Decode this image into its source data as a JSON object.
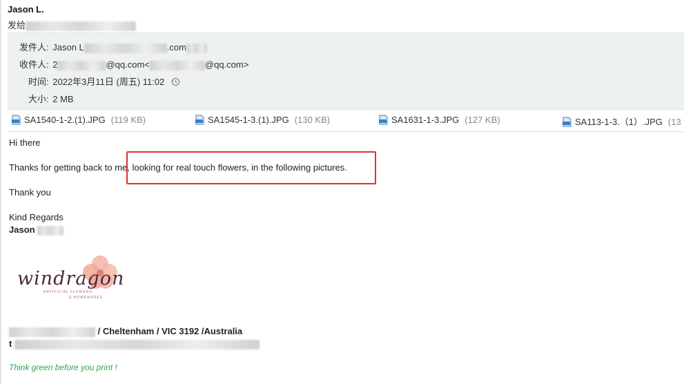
{
  "sender": {
    "name": "Jason L."
  },
  "send_to": {
    "label": "发给"
  },
  "header": {
    "from_label": "发件人:",
    "from_value": "Jason L",
    "from_email_tail": ".com",
    "to_label": "收件人:",
    "to_value_prefix": "2",
    "to_value_mid": "@qq.com<",
    "to_value_suffix": "@qq.com>",
    "time_label": "时间:",
    "time_value": "2022年3月11日 (周五) 11:02",
    "size_label": "大小:",
    "size_value": "2 MB"
  },
  "attachments": [
    {
      "name": "SA1540-1-2.(1).JPG",
      "size": "(119 KB)"
    },
    {
      "name": "SA1545-1-3.(1).JPG",
      "size": "(130 KB)"
    },
    {
      "name": "SA1631-1-3.JPG",
      "size": "(127 KB)"
    },
    {
      "name": "SA113-1-3.（1）.JPG",
      "size": "(13"
    }
  ],
  "message": {
    "greeting": "Hi there",
    "line1": "Thanks for getting back to me, looking for real touch flowers, in the following pictures.",
    "thanks": "Thank you",
    "regards": "Kind Regards",
    "signature_name": "Jason",
    "address": "/ Cheltenham / VIC 3192 /Australia",
    "phone_prefix": "t",
    "green_note": "Think green before you print !"
  },
  "logo": {
    "text": "windragon",
    "sub1": "ARTIFICIAL FLOWERS",
    "sub2": "& HOMEWARES"
  },
  "colors": {
    "header_bg": "#eef1f1",
    "highlight_border": "#e0312f",
    "green_note": "#2fa34f",
    "icon_blue": "#3a7fc4"
  }
}
